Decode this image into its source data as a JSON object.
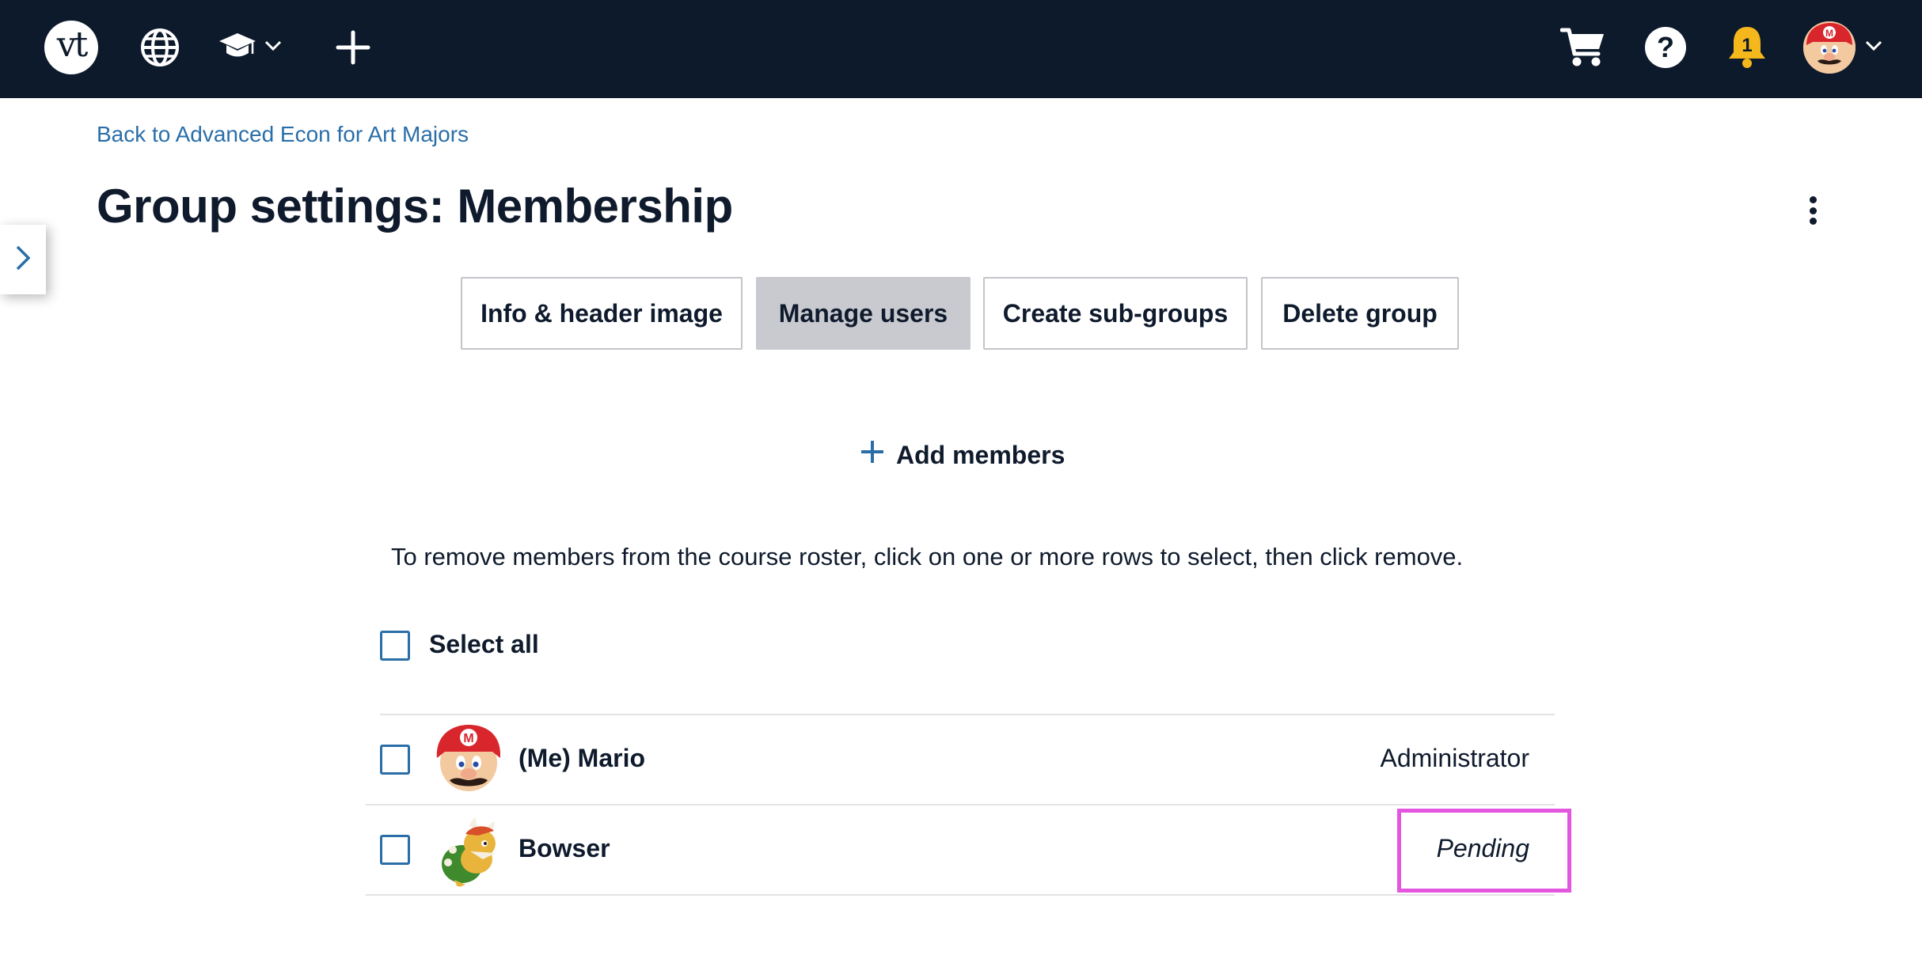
{
  "topbar": {
    "logo_text": "vt",
    "icons": [
      "globe-icon",
      "graduation-cap-icon",
      "chevron-down-icon",
      "plus-icon",
      "cart-icon",
      "help-icon",
      "bell-icon",
      "avatar",
      "chevron-down-icon"
    ],
    "help_glyph": "?",
    "bell_count": "1",
    "colors": {
      "background": "#0d1a2b",
      "bell": "#f5b81c"
    }
  },
  "header": {
    "back_link": "Back to Advanced Econ for Art Majors",
    "title": "Group settings: Membership"
  },
  "tabs": [
    {
      "label": "Info & header image",
      "active": false
    },
    {
      "label": "Manage users",
      "active": true
    },
    {
      "label": "Create sub-groups",
      "active": false
    },
    {
      "label": "Delete group",
      "active": false
    }
  ],
  "add_members": {
    "label": "Add members"
  },
  "instructions": "To remove members from the course roster, click on one or more rows to select, then click remove.",
  "select_all": {
    "label": "Select all"
  },
  "members": [
    {
      "name": "(Me) Mario",
      "role": "Administrator"
    },
    {
      "name": "Bowser",
      "role": "Pending"
    }
  ],
  "colors": {
    "link": "#2a6ea8",
    "active_tab": "#c9cacf",
    "highlight": "#e455e0"
  }
}
